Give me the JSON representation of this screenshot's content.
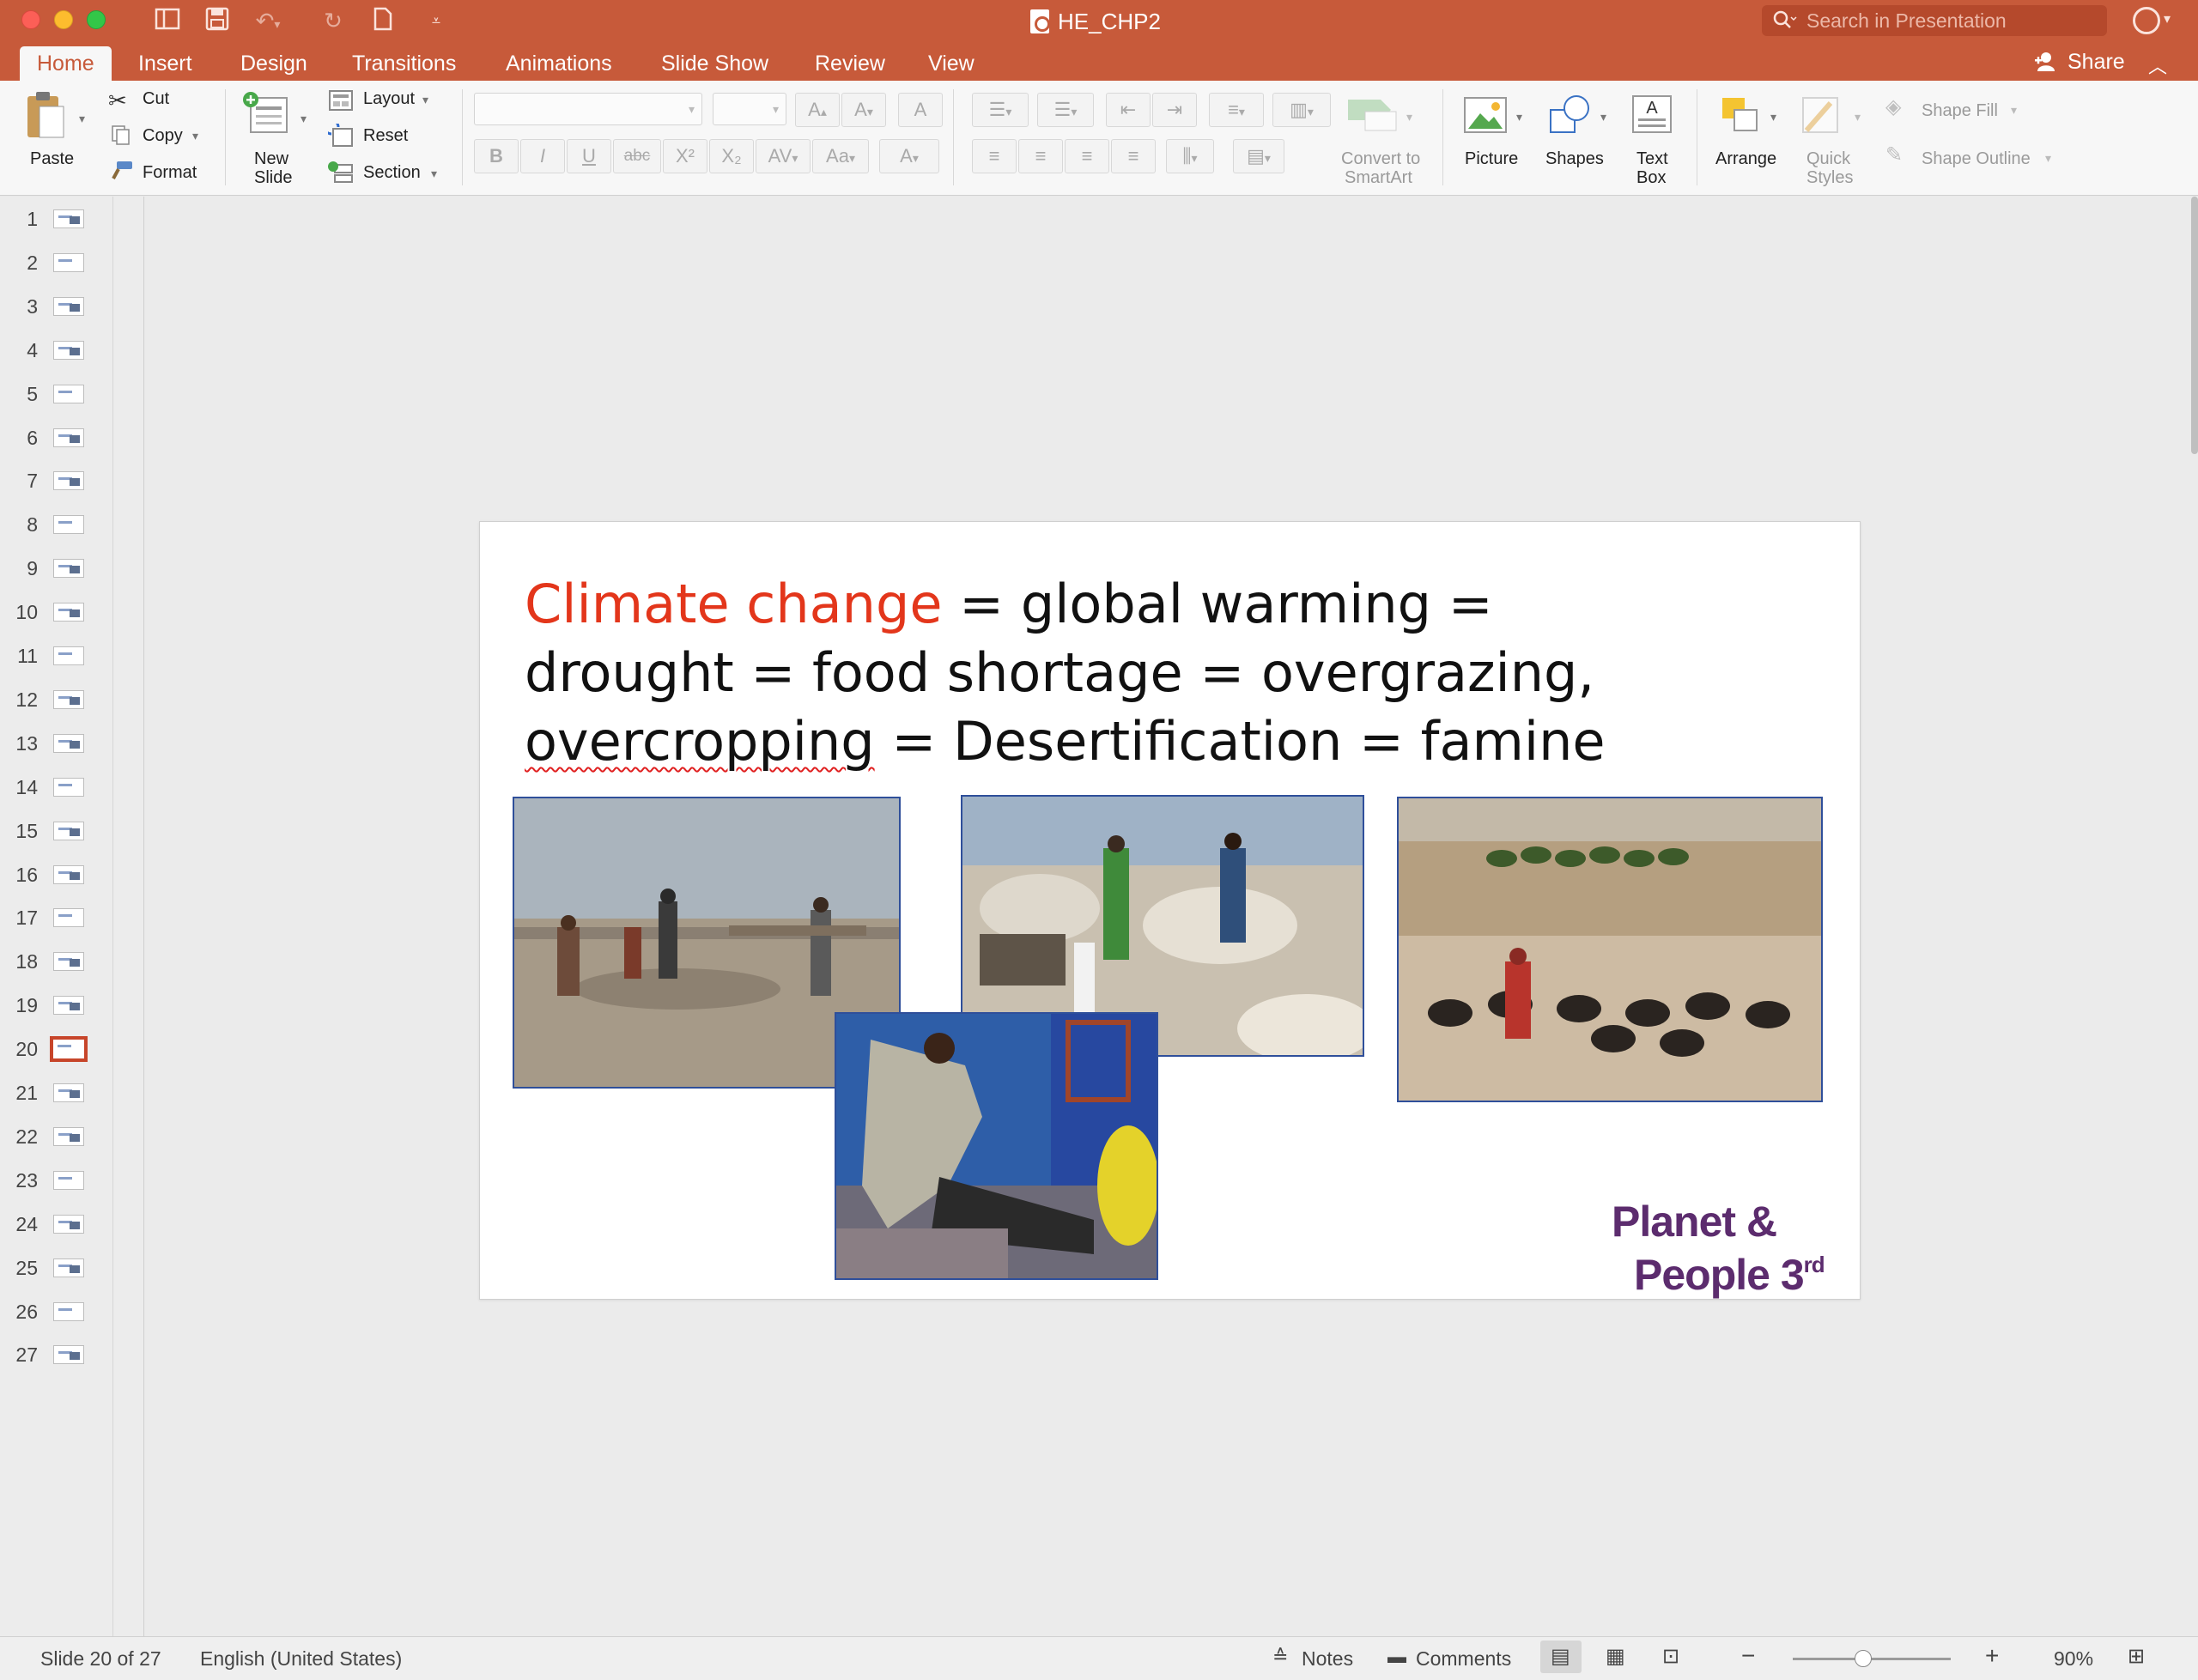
{
  "window": {
    "title": "HE_CHP2"
  },
  "search": {
    "placeholder": "Search in Presentation"
  },
  "tabs": [
    {
      "label": "Home"
    },
    {
      "label": "Insert"
    },
    {
      "label": "Design"
    },
    {
      "label": "Transitions"
    },
    {
      "label": "Animations"
    },
    {
      "label": "Slide Show"
    },
    {
      "label": "Review"
    },
    {
      "label": "View"
    }
  ],
  "share": {
    "label": "Share"
  },
  "ribbon": {
    "paste": "Paste",
    "cut": "Cut",
    "copy": "Copy",
    "format": "Format",
    "new_slide_l1": "New",
    "new_slide_l2": "Slide",
    "layout": "Layout",
    "reset": "Reset",
    "section": "Section",
    "convert_l1": "Convert to",
    "convert_l2": "SmartArt",
    "picture": "Picture",
    "shapes": "Shapes",
    "textbox_l1": "Text",
    "textbox_l2": "Box",
    "arrange": "Arrange",
    "quick_l1": "Quick",
    "quick_l2": "Styles",
    "shape_fill": "Shape Fill",
    "shape_outline": "Shape Outline",
    "font_buttons": [
      "B",
      "I",
      "U",
      "abc",
      "X²",
      "X₂"
    ]
  },
  "thumbnails": {
    "numbers": [
      "1",
      "2",
      "3",
      "4",
      "5",
      "6",
      "7",
      "8",
      "9",
      "10",
      "11",
      "12",
      "13",
      "14",
      "15",
      "16",
      "17",
      "18",
      "19",
      "20",
      "21",
      "22",
      "23",
      "24",
      "25",
      "26",
      "27"
    ],
    "selected": "20"
  },
  "slide": {
    "title_red": "Climate change",
    "title_rest1": " = global warming =",
    "title_line2": "drought = food shortage = overgrazing,",
    "title_line3_word": "overcropping",
    "title_line3_rest": " = Desertification = famine",
    "logo_line1": "Planet &",
    "logo_line2": "People 3",
    "logo_sup": "rd"
  },
  "status": {
    "slide_position": "Slide 20 of 27",
    "language": "English (United States)",
    "notes": "Notes",
    "comments": "Comments",
    "zoom": "90%"
  },
  "colors": {
    "accent": "#c75a3a",
    "title_red": "#e3361b",
    "logo_purple": "#5c2c6e"
  }
}
